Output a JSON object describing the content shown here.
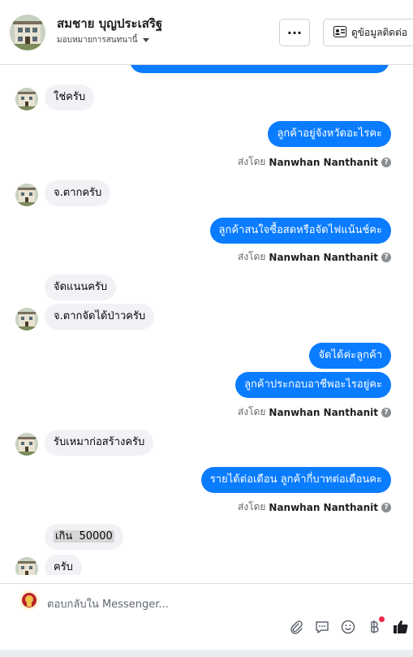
{
  "header": {
    "contact_name": "สมชาย บุญประเสริฐ",
    "assign_label": "มอบหมายการสนทนานี้",
    "more_label": "···",
    "view_contact_label": "ดูข้อมูลติดต่อ"
  },
  "messages": {
    "m1": "ใช่ครับ",
    "m2": "ลูกค้าอยู่จังหวัดอะไรคะ",
    "m3": "จ.ตากครับ",
    "m4": "ลูกค้าสนใจซื้อสดหรือจัดไฟแน้นช์คะ",
    "m5": "จัดแนนครับ",
    "m6": "จ.ตากจัดได้ป่าวครับ",
    "m7": "จัดได้ค่ะลูกค้า",
    "m8": "ลูกค้าประกอบอาชีพอะไรอยู่คะ",
    "m9": "รับเหมาก่อสร้างครับ",
    "m10": "รายได้ต่อเดือน ลูกค้ากี่บาทต่อเดือนคะ",
    "m11": "เกิน  50000",
    "m12": "ครับ"
  },
  "sent_by": {
    "prefix": "ส่งโดย",
    "agent": "Nanwhan Nanthanit"
  },
  "composer": {
    "placeholder": "ตอบกลับใน Messenger..."
  },
  "icons": {
    "attach": "paperclip-icon",
    "saved_replies": "chat-bubble-icon",
    "emoji": "smiley-icon",
    "payment": "baht-icon",
    "like": "thumbs-up-icon"
  },
  "colors": {
    "outgoing_bubble": "#0a7cff",
    "incoming_bubble": "#f0f2f5",
    "notification_dot": "#f02849"
  }
}
